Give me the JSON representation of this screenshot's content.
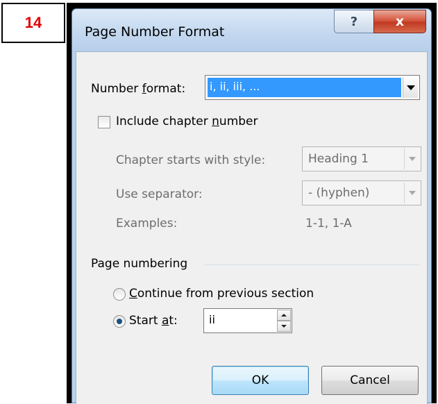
{
  "step_badge": "14",
  "dialog": {
    "title": "Page Number Format",
    "help_glyph": "?",
    "close_glyph": "x"
  },
  "number_format": {
    "label_pre": "Number ",
    "label_accel": "f",
    "label_post": "ormat:",
    "value": "i, ii, iii, ..."
  },
  "chapter": {
    "include_pre": "Include chapter ",
    "include_accel": "n",
    "include_post": "umber",
    "include_checked": false,
    "starts_with_label": "Chapter starts with style:",
    "starts_with_value": "Heading 1",
    "separator_label": "Use separator:",
    "separator_value": "-  (hyphen)",
    "examples_label": "Examples:",
    "examples_value": "1-1, 1-A"
  },
  "page_numbering": {
    "group_label": "Page numbering",
    "continue_accel": "C",
    "continue_rest": "ontinue from previous section",
    "continue_selected": false,
    "start_pre": "Start ",
    "start_accel": "a",
    "start_post": "t:",
    "start_selected": true,
    "start_value": "ii"
  },
  "buttons": {
    "ok": "OK",
    "cancel": "Cancel"
  },
  "colors": {
    "step_badge_text": "#e00000",
    "selection": "#3399ff",
    "close_button": "#c13a22"
  }
}
